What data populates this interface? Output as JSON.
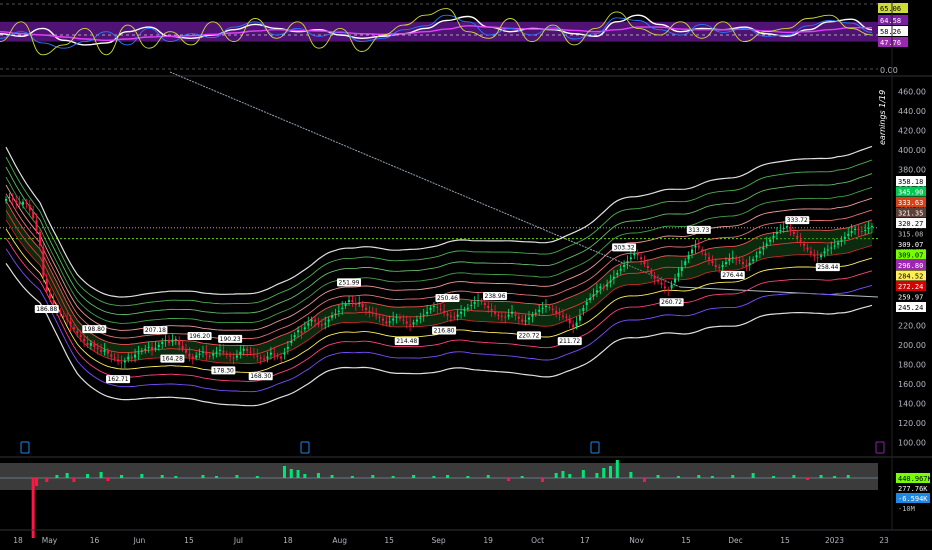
{
  "chart_data": {
    "type": "candlestick",
    "oscillator": {
      "levels_text": [
        "65.06",
        "64.58",
        "58.26",
        "47.76"
      ],
      "axis_ticks": [
        "0.00"
      ],
      "range": [
        0,
        100
      ],
      "band": [
        40,
        70
      ],
      "series": [
        {
          "color": "#ffffff",
          "values": [
            52,
            48,
            60,
            42,
            35,
            38,
            55,
            62,
            48,
            45,
            50,
            58,
            66,
            60,
            55,
            58,
            50,
            45,
            48,
            52,
            60,
            72,
            78,
            62,
            55,
            60,
            58,
            52,
            48,
            70,
            80,
            66,
            55,
            60,
            58,
            62,
            52,
            48,
            58,
            70,
            74,
            58
          ]
        },
        {
          "color": "#e040fb",
          "values": [
            55,
            52,
            50,
            47,
            44,
            42,
            44,
            47,
            48,
            49,
            51,
            53,
            56,
            58,
            57,
            56,
            54,
            52,
            51,
            52,
            55,
            59,
            64,
            62,
            60,
            59,
            59,
            57,
            55,
            58,
            62,
            62,
            59,
            58,
            58,
            59,
            56,
            54,
            55,
            58,
            61,
            61
          ]
        },
        {
          "color": "#2979ff",
          "values": [
            45,
            55,
            38,
            30,
            40,
            55,
            35,
            60,
            40,
            52,
            46,
            62,
            70,
            50,
            60,
            48,
            55,
            40,
            45,
            58,
            64,
            80,
            70,
            50,
            60,
            50,
            62,
            44,
            52,
            76,
            72,
            58,
            50,
            66,
            54,
            60,
            48,
            50,
            64,
            72,
            68,
            54
          ]
        },
        {
          "color": "#cddc39",
          "values": [
            40,
            70,
            20,
            35,
            60,
            20,
            65,
            30,
            55,
            35,
            70,
            40,
            75,
            45,
            70,
            30,
            60,
            25,
            50,
            65,
            80,
            90,
            55,
            45,
            75,
            40,
            65,
            35,
            60,
            85,
            60,
            50,
            70,
            45,
            70,
            40,
            55,
            60,
            75,
            80,
            60,
            50
          ]
        }
      ]
    },
    "price_axis": {
      "range": [
        90,
        470
      ],
      "ticks": [
        "460.00",
        "440.00",
        "420.00",
        "400.00",
        "380.00",
        "360.00",
        "340.00",
        "320.00",
        "300.00",
        "280.00",
        "260.00",
        "240.00",
        "220.00",
        "200.00",
        "180.00",
        "160.00",
        "140.00",
        "120.00",
        "100.00"
      ],
      "tick_values": [
        460,
        440,
        420,
        400,
        380,
        360,
        340,
        320,
        300,
        280,
        260,
        240,
        220,
        200,
        180,
        160,
        140,
        120,
        100
      ]
    },
    "x_axis": {
      "labels": [
        "18",
        "May",
        "16",
        "Jun",
        "15",
        "Jul",
        "18",
        "Aug",
        "15",
        "Sep",
        "19",
        "Oct",
        "17",
        "Nov",
        "15",
        "Dec",
        "15",
        "2023",
        "23"
      ],
      "label_index": [
        0,
        14,
        34,
        54,
        76,
        98,
        120,
        143,
        165,
        187,
        209,
        231,
        252,
        275,
        297,
        319,
        341,
        363,
        385
      ]
    },
    "ohlc_close": [
      350,
      352,
      349,
      346,
      344,
      347,
      345,
      338,
      330,
      318,
      302,
      270,
      255,
      248,
      242,
      236,
      232,
      229,
      226,
      220,
      216,
      212,
      208,
      204,
      200,
      202,
      198,
      196,
      193,
      195,
      191,
      188,
      186,
      183,
      181,
      184,
      188,
      186,
      190,
      192,
      194,
      196,
      198,
      195,
      197,
      200,
      203,
      205,
      202,
      204,
      206,
      200,
      196,
      192,
      188,
      186,
      189,
      191,
      193,
      190,
      188,
      191,
      193,
      195,
      192,
      190,
      188,
      186,
      189,
      193,
      196,
      194,
      192,
      190,
      188,
      186,
      185,
      188,
      192,
      190,
      188,
      186,
      192,
      198,
      204,
      210,
      215,
      212,
      218,
      222,
      226,
      224,
      221,
      220,
      222,
      226,
      230,
      232,
      235,
      238,
      242,
      246,
      244,
      241,
      243,
      239,
      236,
      234,
      232,
      230,
      228,
      225,
      222,
      224,
      227,
      229,
      227,
      225,
      222,
      220,
      223,
      226,
      228,
      231,
      234,
      238,
      240,
      238,
      236,
      233,
      230,
      229,
      228,
      231,
      234,
      236,
      238,
      241,
      244,
      246,
      244,
      241,
      238,
      235,
      232,
      230,
      229,
      228,
      231,
      234,
      230,
      227,
      224,
      225,
      228,
      231,
      233,
      236,
      238,
      240,
      238,
      236,
      233,
      231,
      229,
      228,
      222,
      218,
      223,
      230,
      238,
      244,
      248,
      252,
      256,
      260,
      258,
      262,
      266,
      270,
      274,
      278,
      282,
      286,
      290,
      294,
      292,
      288,
      283,
      279,
      273,
      268,
      265,
      262,
      258,
      256,
      262,
      268,
      274,
      280,
      286,
      292,
      298,
      302,
      300,
      296,
      292,
      288,
      284,
      280,
      279,
      282,
      285,
      288,
      290,
      288,
      286,
      283,
      281,
      284,
      288,
      292,
      296,
      300,
      304,
      308,
      312,
      316,
      318,
      320,
      322,
      318,
      314,
      310,
      306,
      302,
      298,
      294,
      291,
      289,
      292,
      296,
      298,
      300,
      302,
      305,
      308,
      311,
      314,
      317,
      319,
      318,
      316,
      318,
      320,
      322
    ],
    "ohlc_open": [
      348,
      351,
      351,
      348,
      346,
      344,
      346,
      344,
      337,
      328,
      316,
      300,
      268,
      253,
      246,
      240,
      234,
      230,
      227,
      224,
      218,
      214,
      210,
      206,
      202,
      199,
      201,
      197,
      195,
      193,
      194,
      190,
      187,
      185,
      182,
      182,
      185,
      188,
      187,
      191,
      193,
      195,
      197,
      198,
      196,
      198,
      201,
      204,
      204,
      203,
      205,
      205,
      199,
      195,
      191,
      188,
      187,
      190,
      192,
      193,
      189,
      189,
      192,
      194,
      194,
      191,
      189,
      187,
      187,
      190,
      194,
      196,
      193,
      191,
      189,
      187,
      186,
      186,
      190,
      191,
      189,
      188,
      190,
      196,
      202,
      208,
      213,
      214,
      216,
      220,
      224,
      226,
      223,
      221,
      221,
      224,
      228,
      231,
      234,
      237,
      240,
      244,
      246,
      243,
      242,
      242,
      238,
      235,
      233,
      231,
      229,
      227,
      224,
      223,
      225,
      228,
      228,
      226,
      224,
      221,
      221,
      224,
      227,
      230,
      232,
      236,
      239,
      239,
      237,
      235,
      232,
      230,
      229,
      229,
      232,
      235,
      237,
      240,
      242,
      245,
      245,
      243,
      240,
      237,
      234,
      231,
      230,
      229,
      229,
      232,
      232,
      229,
      226,
      224,
      226,
      229,
      232,
      234,
      237,
      239,
      239,
      237,
      235,
      232,
      230,
      229,
      227,
      221,
      219,
      225,
      235,
      241,
      246,
      250,
      254,
      258,
      259,
      260,
      264,
      268,
      272,
      276,
      280,
      284,
      288,
      292,
      294,
      290,
      286,
      281,
      276,
      271,
      267,
      264,
      260,
      257,
      258,
      264,
      270,
      276,
      282,
      288,
      294,
      300,
      302,
      298,
      294,
      290,
      286,
      282,
      280,
      280,
      283,
      286,
      289,
      289,
      287,
      285,
      282,
      282,
      286,
      290,
      294,
      298,
      302,
      306,
      310,
      314,
      317,
      319,
      321,
      320,
      316,
      312,
      308,
      304,
      300,
      296,
      292,
      290,
      290,
      294,
      297,
      299,
      301,
      303,
      306,
      309,
      312,
      315,
      318,
      319,
      317,
      317,
      319,
      321
    ],
    "bands": {
      "levels_text": [
        "358.18",
        "345.90",
        "333.63",
        "321.35",
        "320.27",
        "315.08",
        "309.07",
        "309.07",
        "296.80",
        "284.52",
        "272.24",
        "259.97",
        "245.24"
      ],
      "ladder_offsets": [
        95,
        80,
        65,
        50,
        38,
        25,
        14,
        0,
        -14,
        -28,
        -42,
        -58,
        -80
      ],
      "ladder_colors": [
        "#e0e0e0",
        "#4caf50",
        "#66bb6a",
        "#43a047",
        "#ef9a9a",
        "#e57373",
        "#ef5350",
        "#e53935",
        "#c62828",
        "#ffee58",
        "#ff4081",
        "#7c4dff",
        "#e0e0e0"
      ]
    },
    "tag_labels": [
      {
        "i": 12,
        "text": "186.88",
        "pos": "below"
      },
      {
        "i": 26,
        "text": "198.80",
        "pos": "above"
      },
      {
        "i": 33,
        "text": "162.71",
        "pos": "below"
      },
      {
        "i": 44,
        "text": "207.18",
        "pos": "above"
      },
      {
        "i": 49,
        "text": "164.28",
        "pos": "below"
      },
      {
        "i": 57,
        "text": "196.20",
        "pos": "above"
      },
      {
        "i": 66,
        "text": "190.23",
        "pos": "above"
      },
      {
        "i": 64,
        "text": "178.30",
        "pos": "below"
      },
      {
        "i": 75,
        "text": "168.30",
        "pos": "below"
      },
      {
        "i": 101,
        "text": "251.99",
        "pos": "above"
      },
      {
        "i": 118,
        "text": "214.48",
        "pos": "below"
      },
      {
        "i": 129,
        "text": "216.80",
        "pos": "below"
      },
      {
        "i": 130,
        "text": "250.46",
        "pos": "above"
      },
      {
        "i": 144,
        "text": "238.96",
        "pos": "above"
      },
      {
        "i": 154,
        "text": "220.72",
        "pos": "below"
      },
      {
        "i": 166,
        "text": "211.72",
        "pos": "below"
      },
      {
        "i": 182,
        "text": "303.32",
        "pos": "above"
      },
      {
        "i": 196,
        "text": "260.72",
        "pos": "below"
      },
      {
        "i": 204,
        "text": "313.73",
        "pos": "above"
      },
      {
        "i": 214,
        "text": "276.44",
        "pos": "below"
      },
      {
        "i": 233,
        "text": "333.72",
        "pos": "above"
      },
      {
        "i": 242,
        "text": "258.44",
        "pos": "below"
      }
    ],
    "sidebar_label": "earnings 1/19",
    "volume": {
      "levels_text": [
        "440.967K",
        "277.76K",
        "-6.594K",
        "-10M"
      ],
      "bars": [
        {
          "i": 8,
          "v": -60
        },
        {
          "i": 9,
          "v": -8
        },
        {
          "i": 12,
          "v": -4
        },
        {
          "i": 15,
          "v": 3
        },
        {
          "i": 18,
          "v": 5
        },
        {
          "i": 20,
          "v": -4
        },
        {
          "i": 24,
          "v": 4
        },
        {
          "i": 28,
          "v": 6
        },
        {
          "i": 30,
          "v": -3
        },
        {
          "i": 34,
          "v": 3
        },
        {
          "i": 40,
          "v": 4
        },
        {
          "i": 46,
          "v": 3
        },
        {
          "i": 50,
          "v": 2
        },
        {
          "i": 58,
          "v": 3
        },
        {
          "i": 62,
          "v": 2
        },
        {
          "i": 68,
          "v": 3
        },
        {
          "i": 74,
          "v": 2
        },
        {
          "i": 82,
          "v": 12
        },
        {
          "i": 84,
          "v": 9
        },
        {
          "i": 86,
          "v": 8
        },
        {
          "i": 88,
          "v": 4
        },
        {
          "i": 92,
          "v": 5
        },
        {
          "i": 96,
          "v": 3
        },
        {
          "i": 102,
          "v": 2
        },
        {
          "i": 108,
          "v": 3
        },
        {
          "i": 114,
          "v": 2
        },
        {
          "i": 120,
          "v": 3
        },
        {
          "i": 126,
          "v": 2
        },
        {
          "i": 130,
          "v": 3
        },
        {
          "i": 136,
          "v": 2
        },
        {
          "i": 142,
          "v": 3
        },
        {
          "i": 148,
          "v": -3
        },
        {
          "i": 152,
          "v": 2
        },
        {
          "i": 158,
          "v": -4
        },
        {
          "i": 162,
          "v": 5
        },
        {
          "i": 164,
          "v": 7
        },
        {
          "i": 166,
          "v": 4
        },
        {
          "i": 170,
          "v": 8
        },
        {
          "i": 174,
          "v": 5
        },
        {
          "i": 176,
          "v": 10
        },
        {
          "i": 178,
          "v": 12
        },
        {
          "i": 180,
          "v": 18
        },
        {
          "i": 184,
          "v": 6
        },
        {
          "i": 188,
          "v": -4
        },
        {
          "i": 192,
          "v": 3
        },
        {
          "i": 198,
          "v": 2
        },
        {
          "i": 204,
          "v": 3
        },
        {
          "i": 208,
          "v": 2
        },
        {
          "i": 214,
          "v": 3
        },
        {
          "i": 220,
          "v": 5
        },
        {
          "i": 226,
          "v": 2
        },
        {
          "i": 232,
          "v": 3
        },
        {
          "i": 236,
          "v": -2
        },
        {
          "i": 240,
          "v": 3
        },
        {
          "i": 244,
          "v": 2
        },
        {
          "i": 248,
          "v": 3
        }
      ]
    }
  }
}
